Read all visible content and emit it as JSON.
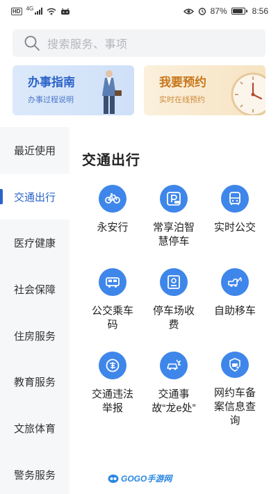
{
  "status_bar": {
    "network": "4G",
    "battery": "87%",
    "battery_level": 0.87,
    "time": "8:56"
  },
  "search": {
    "placeholder": "搜索服务、事项"
  },
  "banners": [
    {
      "title": "办事指南",
      "subtitle": "办事过程说明"
    },
    {
      "title": "我要预约",
      "subtitle": "实时在线预约"
    }
  ],
  "sidebar": {
    "items": [
      {
        "label": "最近使用"
      },
      {
        "label": "交通出行",
        "active": true
      },
      {
        "label": "医疗健康"
      },
      {
        "label": "社会保障"
      },
      {
        "label": "住房服务"
      },
      {
        "label": "教育服务"
      },
      {
        "label": "文旅体育"
      },
      {
        "label": "警务服务"
      }
    ]
  },
  "section": {
    "title": "交通出行",
    "services": [
      {
        "label": "永安行",
        "icon": "bicycle-icon"
      },
      {
        "label": "常享泊智慧停车",
        "icon": "parking-icon"
      },
      {
        "label": "实时公交",
        "icon": "bus-icon"
      },
      {
        "label": "公交乘车码",
        "icon": "bus-code-icon"
      },
      {
        "label": "停车场收费",
        "icon": "parking-fee-icon"
      },
      {
        "label": "自助移车",
        "icon": "tow-truck-icon"
      },
      {
        "label": "交通违法举报",
        "icon": "violation-report-icon"
      },
      {
        "label": "交通事故“龙e处”",
        "icon": "car-accident-icon"
      },
      {
        "label": "网约车备案信息查询",
        "icon": "ride-hailing-query-icon"
      }
    ]
  },
  "watermark": {
    "text": "GOGO手游网"
  },
  "colors": {
    "accent": "#2b63c9",
    "icon_bg": "#3f86ea",
    "sidebar_bg": "#f6f7f9"
  }
}
